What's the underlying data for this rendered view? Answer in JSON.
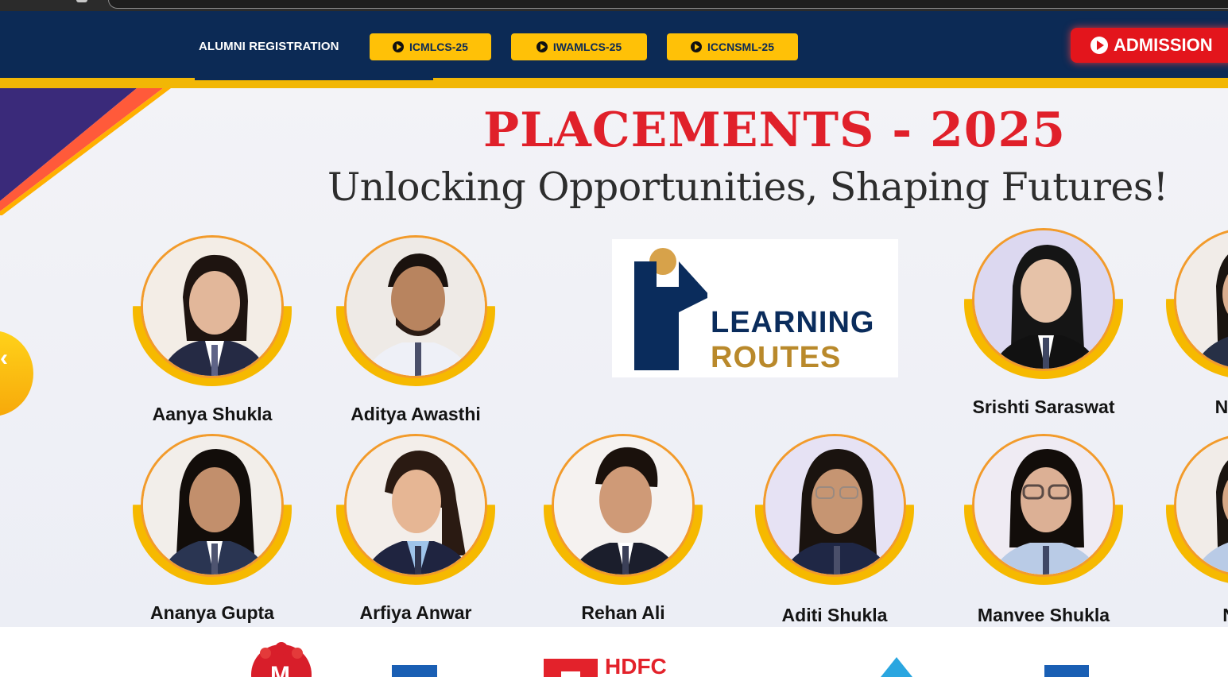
{
  "nav": {
    "alumni_label": "ALUMNI REGISTRATION",
    "buttons": [
      {
        "label": "ICMLCS-25"
      },
      {
        "label": "IWAMLCS-25"
      },
      {
        "label": "ICCNSML-25"
      }
    ],
    "admission_label": "ADMISSION"
  },
  "banner": {
    "title": "PLACEMENTS - 2025",
    "subtitle": "Unlocking Opportunities, Shaping Futures!",
    "students": [
      {
        "name": "Aanya Shukla"
      },
      {
        "name": "Aditya Awasthi"
      },
      {
        "name": "Srishti Saraswat"
      },
      {
        "name": "Nainsh"
      },
      {
        "name": "Ananya Gupta"
      },
      {
        "name": "Arfiya Anwar"
      },
      {
        "name": "Rehan Ali"
      },
      {
        "name": "Aditi Shukla"
      },
      {
        "name": "Manvee Shukla"
      },
      {
        "name": "Nidhi"
      }
    ],
    "company_logo": {
      "line1": "LEARNING",
      "line2": "ROUTES"
    }
  },
  "recruiters": {
    "hdfc": "HDFC"
  },
  "colors": {
    "navy": "#0c2a55",
    "yellow": "#ffc107",
    "red": "#e3151c",
    "headline_red": "#e0202a"
  }
}
